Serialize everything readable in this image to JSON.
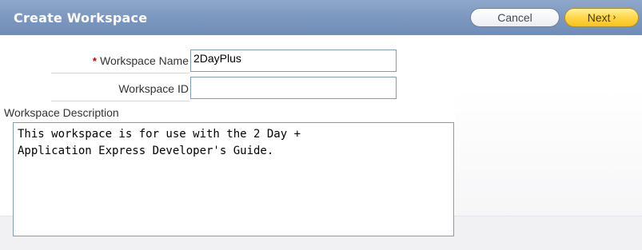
{
  "header": {
    "title": "Create Workspace",
    "cancel_label": "Cancel",
    "next_label": "Next",
    "next_chevron": "›"
  },
  "form": {
    "workspace_name": {
      "label": "Workspace Name",
      "required_marker": "*",
      "value": "2DayPlus"
    },
    "workspace_id": {
      "label": "Workspace ID",
      "value": ""
    },
    "workspace_description": {
      "label": "Workspace Description",
      "value": "This workspace is for use with the 2 Day +\nApplication Express Developer's Guide."
    }
  }
}
